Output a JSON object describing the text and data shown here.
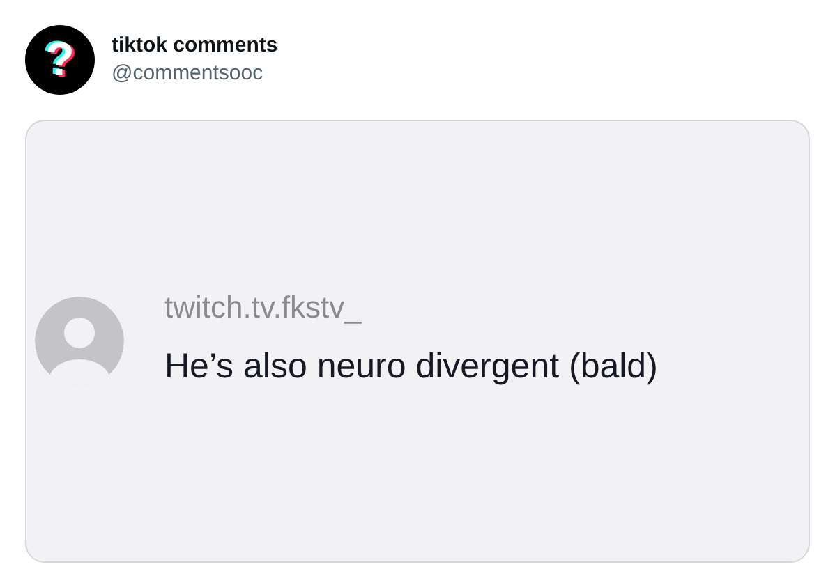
{
  "tweet": {
    "avatar_glyph": "?",
    "author_name": "tiktok comments",
    "handle": "@commentsooc",
    "media": {
      "comment": {
        "username": "twitch.tv.fkstv_",
        "text": "He’s also neuro divergent (bald)"
      }
    }
  }
}
